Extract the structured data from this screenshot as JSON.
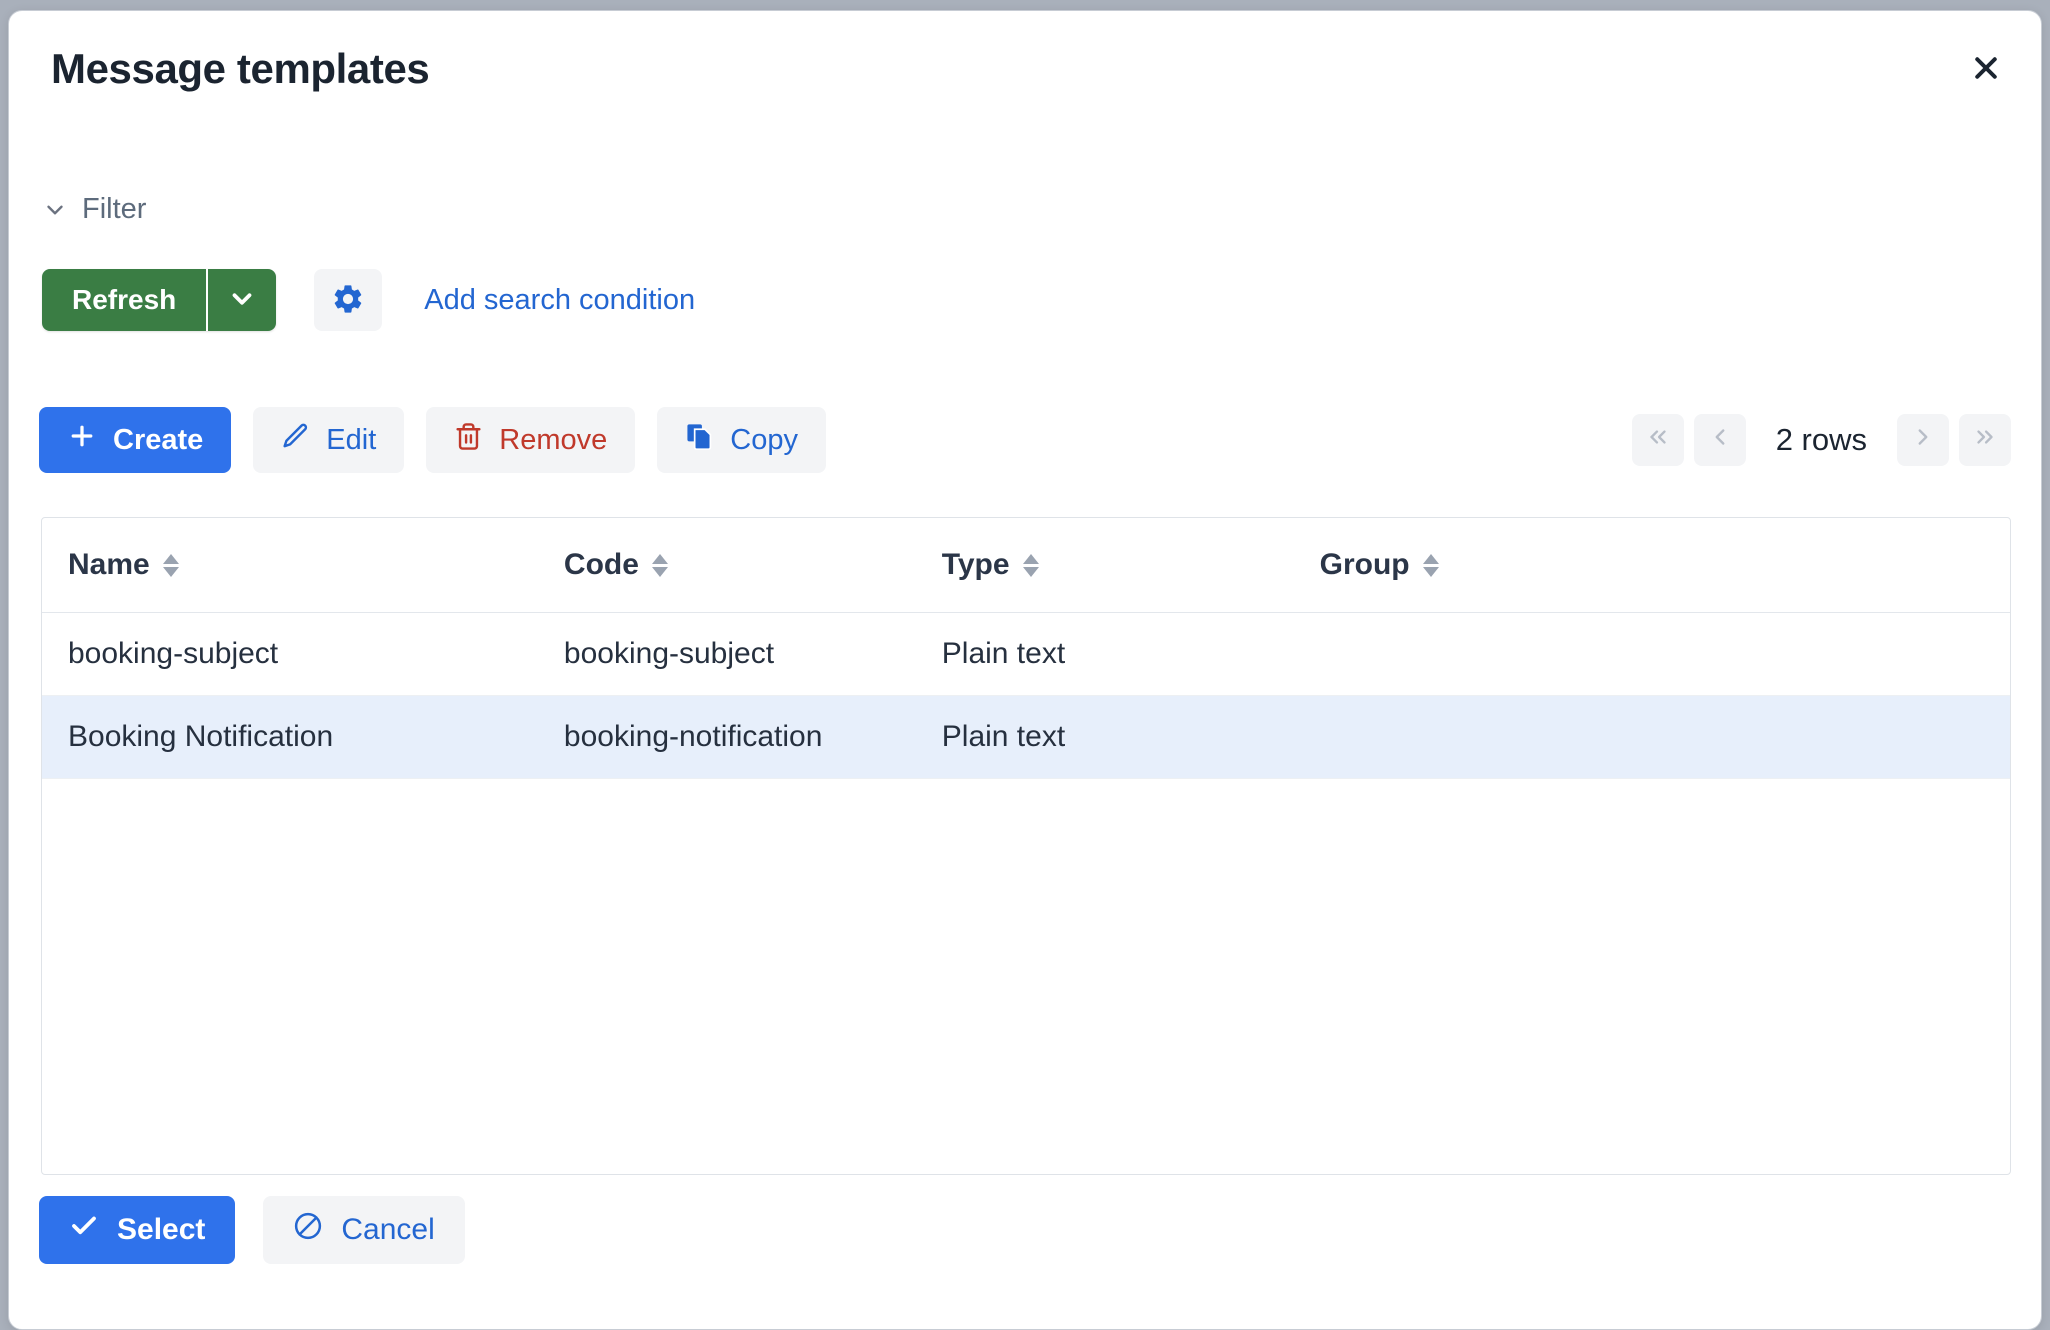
{
  "dialog": {
    "title": "Message templates",
    "close_icon": "close-icon"
  },
  "filter": {
    "label": "Filter",
    "chevron_icon": "chevron-down-icon"
  },
  "toolbar": {
    "refresh_label": "Refresh",
    "refresh_caret_icon": "chevron-down-icon",
    "settings_icon": "gear-icon",
    "add_condition_label": "Add search condition"
  },
  "actions": {
    "create_label": "Create",
    "create_icon": "plus-icon",
    "edit_label": "Edit",
    "edit_icon": "pencil-icon",
    "remove_label": "Remove",
    "remove_icon": "trash-icon",
    "copy_label": "Copy",
    "copy_icon": "copy-icon"
  },
  "pagination": {
    "first_icon": "double-chevron-left-icon",
    "prev_icon": "chevron-left-icon",
    "rows_label": "2 rows",
    "next_icon": "chevron-right-icon",
    "last_icon": "double-chevron-right-icon"
  },
  "table": {
    "columns": [
      {
        "label": "Name",
        "sort_icon": "sort-icon"
      },
      {
        "label": "Code",
        "sort_icon": "sort-icon"
      },
      {
        "label": "Type",
        "sort_icon": "sort-icon"
      },
      {
        "label": "Group",
        "sort_icon": "sort-icon"
      }
    ],
    "rows": [
      {
        "name": "booking-subject",
        "code": "booking-subject",
        "type": "Plain text",
        "group": "",
        "selected": false
      },
      {
        "name": "Booking Notification",
        "code": "booking-notification",
        "type": "Plain text",
        "group": "",
        "selected": true
      }
    ]
  },
  "footer": {
    "select_label": "Select",
    "select_icon": "check-icon",
    "cancel_label": "Cancel",
    "cancel_icon": "ban-icon"
  },
  "colors": {
    "green": "#3a7d44",
    "blue": "#2f72eb",
    "link_blue": "#2366d1",
    "red": "#c0392b",
    "selected_row": "#e7effb",
    "button_grey": "#f3f4f6"
  }
}
